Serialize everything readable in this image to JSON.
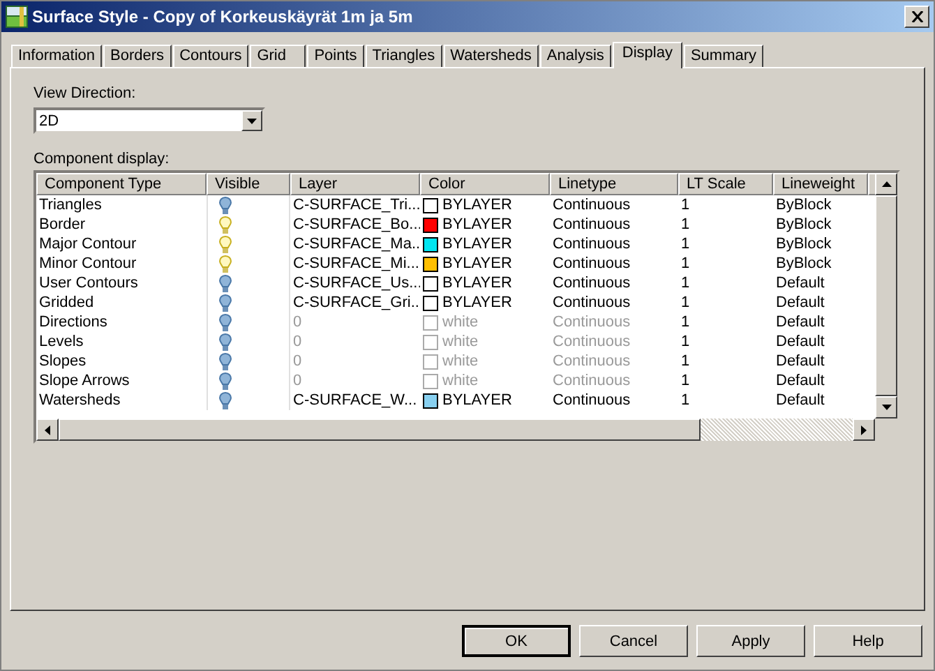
{
  "window": {
    "title": "Surface Style - Copy of Korkeuskäyrät 1m ja 5m"
  },
  "tabs": [
    {
      "label": "Information",
      "selected": false
    },
    {
      "label": "Borders",
      "selected": false
    },
    {
      "label": "Contours",
      "selected": false
    },
    {
      "label": "Grid",
      "selected": false
    },
    {
      "label": "Points",
      "selected": false
    },
    {
      "label": "Triangles",
      "selected": false
    },
    {
      "label": "Watersheds",
      "selected": false
    },
    {
      "label": "Analysis",
      "selected": false
    },
    {
      "label": "Display",
      "selected": true
    },
    {
      "label": "Summary",
      "selected": false
    }
  ],
  "view_direction": {
    "label": "View Direction:",
    "value": "2D"
  },
  "component_display": {
    "label": "Component display:",
    "columns": [
      "Component Type",
      "Visible",
      "Layer",
      "Color",
      "Linetype",
      "LT Scale",
      "Lineweight"
    ],
    "rows": [
      {
        "type": "Triangles",
        "visible": false,
        "layer": "C-SURFACE_Tri...",
        "color": "#ffffff",
        "color_name": "BYLAYER",
        "linetype": "Continuous",
        "lt_scale": "1",
        "lineweight": "ByBlock",
        "dimmed": false
      },
      {
        "type": "Border",
        "visible": true,
        "layer": "C-SURFACE_Bo...",
        "color": "#ff0000",
        "color_name": "BYLAYER",
        "linetype": "Continuous",
        "lt_scale": "1",
        "lineweight": "ByBlock",
        "dimmed": false
      },
      {
        "type": "Major Contour",
        "visible": true,
        "layer": "C-SURFACE_Ma...",
        "color": "#00e5f0",
        "color_name": "BYLAYER",
        "linetype": "Continuous",
        "lt_scale": "1",
        "lineweight": "ByBlock",
        "dimmed": false
      },
      {
        "type": "Minor Contour",
        "visible": true,
        "layer": "C-SURFACE_Mi...",
        "color": "#ffbf00",
        "color_name": "BYLAYER",
        "linetype": "Continuous",
        "lt_scale": "1",
        "lineweight": "ByBlock",
        "dimmed": false
      },
      {
        "type": "User Contours",
        "visible": false,
        "layer": "C-SURFACE_Us...",
        "color": "#ffffff",
        "color_name": "BYLAYER",
        "linetype": "Continuous",
        "lt_scale": "1",
        "lineweight": "Default",
        "dimmed": false
      },
      {
        "type": "Gridded",
        "visible": false,
        "layer": "C-SURFACE_Gri...",
        "color": "#ffffff",
        "color_name": "BYLAYER",
        "linetype": "Continuous",
        "lt_scale": "1",
        "lineweight": "Default",
        "dimmed": false
      },
      {
        "type": "Directions",
        "visible": false,
        "layer": "0",
        "color": "#ffffff",
        "color_name": "white",
        "linetype": "Continuous",
        "lt_scale": "1",
        "lineweight": "Default",
        "dimmed": true
      },
      {
        "type": "Levels",
        "visible": false,
        "layer": "0",
        "color": "#ffffff",
        "color_name": "white",
        "linetype": "Continuous",
        "lt_scale": "1",
        "lineweight": "Default",
        "dimmed": true
      },
      {
        "type": "Slopes",
        "visible": false,
        "layer": "0",
        "color": "#ffffff",
        "color_name": "white",
        "linetype": "Continuous",
        "lt_scale": "1",
        "lineweight": "Default",
        "dimmed": true
      },
      {
        "type": "Slope Arrows",
        "visible": false,
        "layer": "0",
        "color": "#ffffff",
        "color_name": "white",
        "linetype": "Continuous",
        "lt_scale": "1",
        "lineweight": "Default",
        "dimmed": true
      },
      {
        "type": "Watersheds",
        "visible": false,
        "layer": "C-SURFACE_W...",
        "color": "#88d0f0",
        "color_name": "BYLAYER",
        "linetype": "Continuous",
        "lt_scale": "1",
        "lineweight": "Default",
        "dimmed": false
      }
    ]
  },
  "buttons": [
    {
      "label": "OK",
      "default": true
    },
    {
      "label": "Cancel",
      "default": false
    },
    {
      "label": "Apply",
      "default": false
    },
    {
      "label": "Help",
      "default": false
    }
  ]
}
